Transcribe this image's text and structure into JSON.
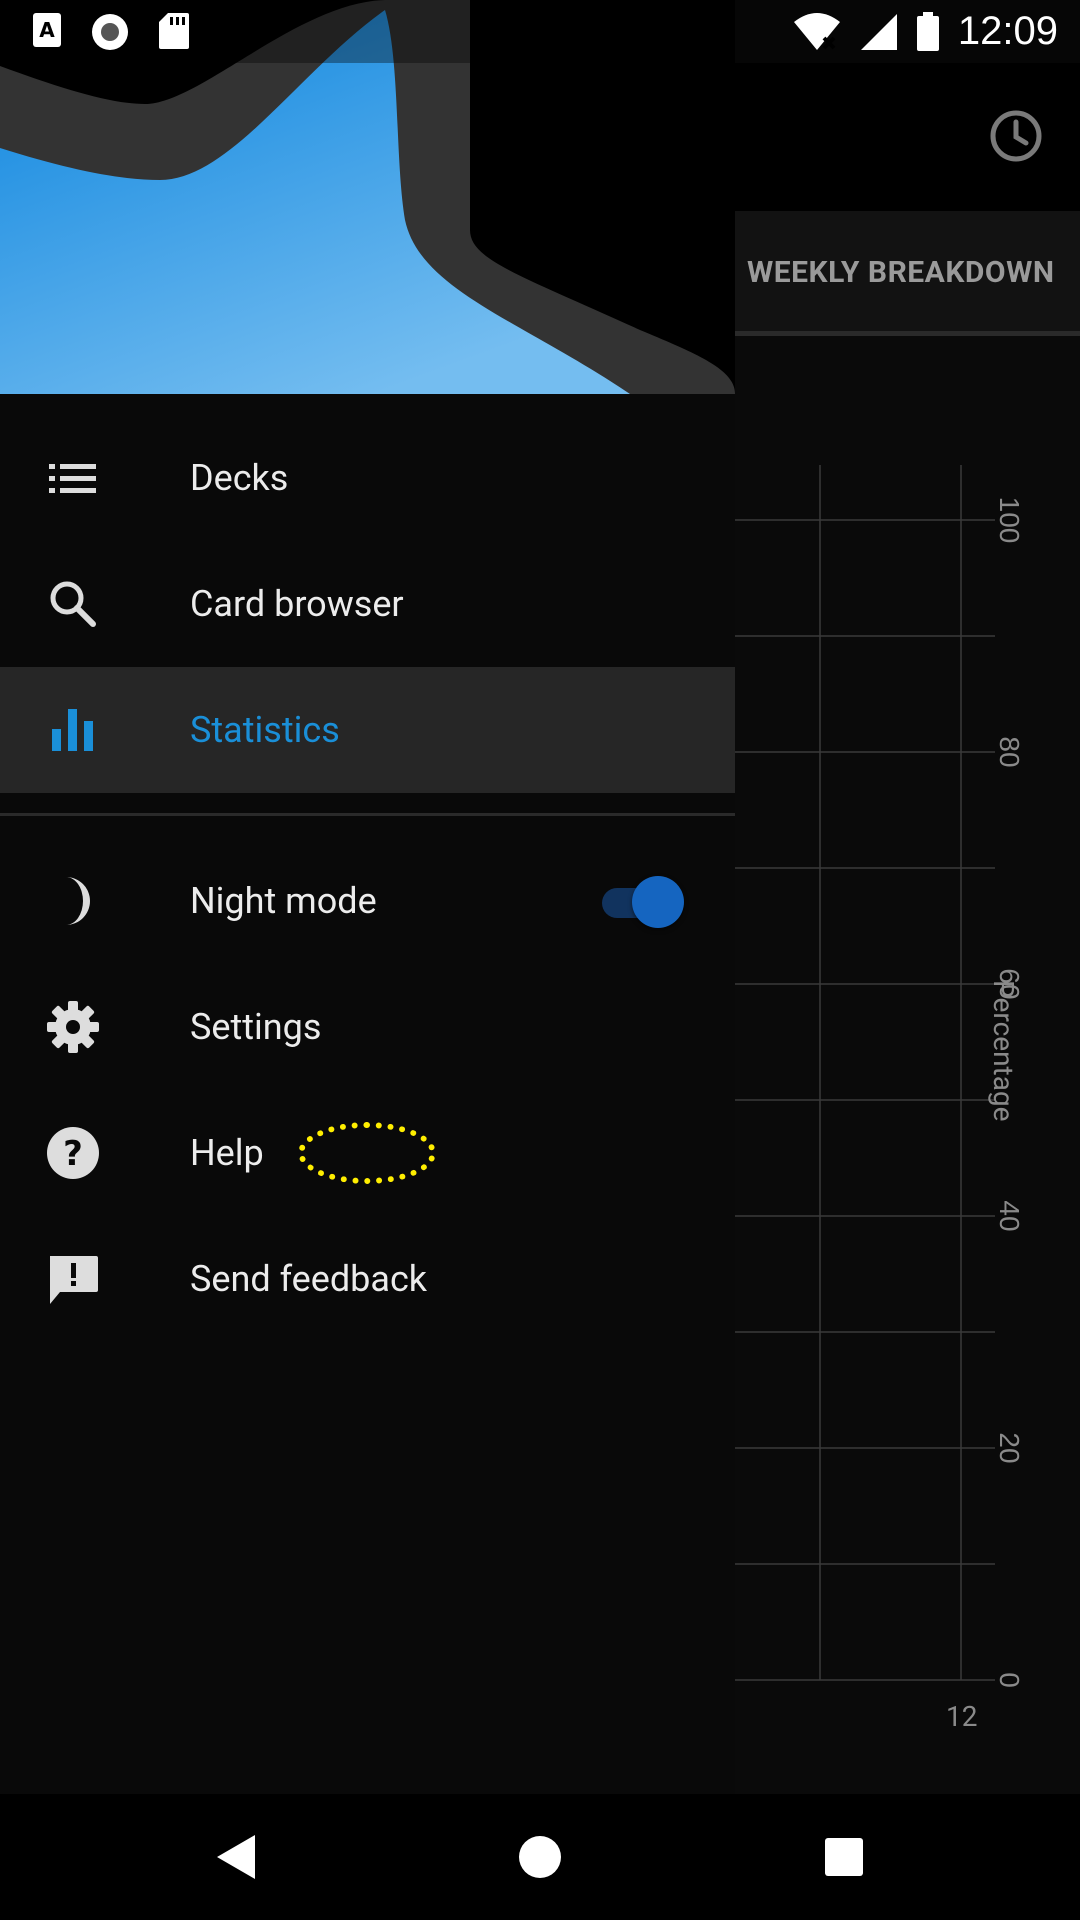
{
  "status_bar": {
    "time": "12:09",
    "icons": [
      "font-icon",
      "record-icon",
      "sd-card-icon",
      "wifi-icon",
      "signal-icon",
      "battery-icon"
    ]
  },
  "background": {
    "tab_label": "WEEKLY BREAKDOWN",
    "chart_data": {
      "type": "bar",
      "ylabel": "Percentage",
      "ylim": [
        0,
        100
      ],
      "y_ticks": [
        "0",
        "20",
        "40",
        "60",
        "80",
        "100"
      ],
      "x_ticks": [
        "12"
      ],
      "grid": true,
      "series": []
    }
  },
  "drawer": {
    "items": [
      {
        "label": "Decks",
        "icon": "list-icon"
      },
      {
        "label": "Card browser",
        "icon": "search-icon"
      },
      {
        "label": "Statistics",
        "icon": "bar-chart-icon",
        "active": true
      },
      {
        "label": "Night mode",
        "icon": "moon-icon",
        "toggle": true
      },
      {
        "label": "Settings",
        "icon": "gear-icon"
      },
      {
        "label": "Help",
        "icon": "help-icon"
      },
      {
        "label": "Send feedback",
        "icon": "feedback-icon"
      }
    ],
    "night_mode_on": true
  },
  "colors": {
    "accent": "#1a8fd8",
    "toggle_thumb": "#1565c0",
    "toggle_track": "#11335e",
    "highlight": "#ffee00"
  },
  "nav": [
    "back-icon",
    "home-icon",
    "recents-icon"
  ]
}
